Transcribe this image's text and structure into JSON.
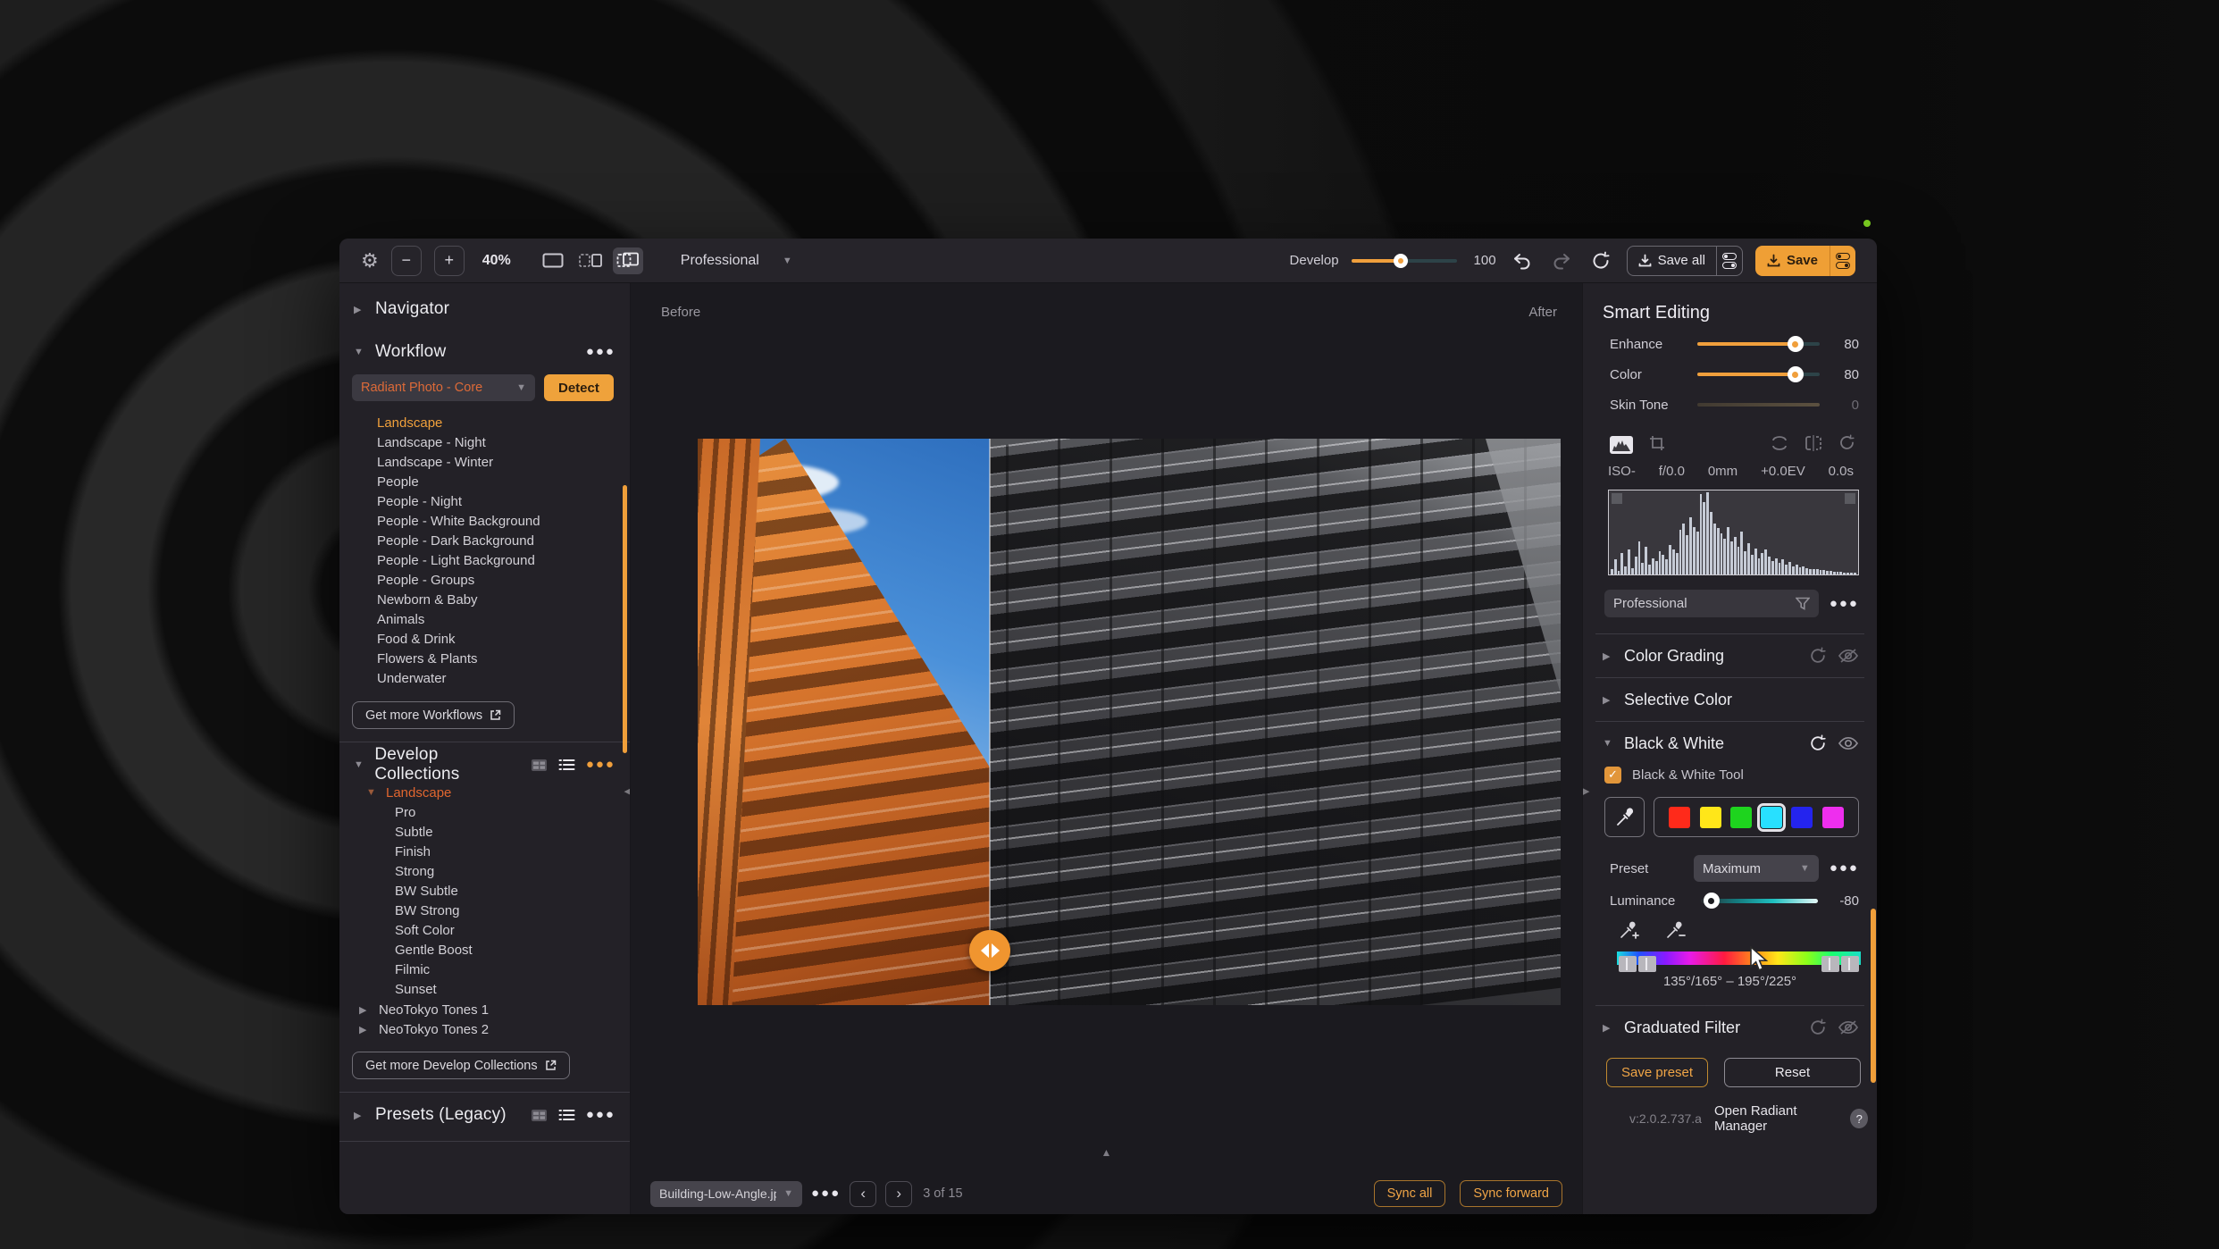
{
  "app": {
    "toolbar": {
      "zoom_value": "40%",
      "minus": "−",
      "plus": "+",
      "profile": "Professional",
      "develop_label": "Develop",
      "develop_value": "100",
      "develop_percent": 47,
      "save_all_label": "Save all",
      "save_label": "Save"
    },
    "sidebar": {
      "navigator_title": "Navigator",
      "workflow": {
        "title": "Workflow",
        "engine_value": "Radiant Photo - Core",
        "detect_label": "Detect",
        "items": [
          {
            "label": "Landscape",
            "selected": true
          },
          "Landscape - Night",
          "Landscape - Winter",
          "People",
          "People - Night",
          "People - White Background",
          "People - Dark Background",
          "People - Light Background",
          "People - Groups",
          "Newborn & Baby",
          "Animals",
          "Food & Drink",
          "Flowers & Plants",
          "Underwater"
        ],
        "get_more_label": "Get more Workflows"
      },
      "develop_collections": {
        "title": "Develop Collections",
        "group_title": "Landscape",
        "items": [
          "Pro",
          "Subtle",
          "Finish",
          "Strong",
          "BW Subtle",
          "BW Strong",
          "Soft Color",
          "Gentle Boost",
          "Filmic",
          "Sunset"
        ],
        "collapsed_groups": [
          "NeoTokyo Tones 1",
          "NeoTokyo Tones 2"
        ],
        "get_more_label": "Get more Develop Collections"
      },
      "presets_title": "Presets (Legacy)"
    },
    "canvas": {
      "before_label": "Before",
      "after_label": "After",
      "filename": "Building-Low-Angle.jp",
      "counter": "3 of 15",
      "sync_all_label": "Sync all",
      "sync_forward_label": "Sync forward"
    },
    "panel": {
      "title": "Smart Editing",
      "sliders": [
        {
          "label": "Enhance",
          "value": "80",
          "percent": 80,
          "disabled": false
        },
        {
          "label": "Color",
          "value": "80",
          "percent": 80,
          "disabled": false
        },
        {
          "label": "Skin Tone",
          "value": "0",
          "percent": 0,
          "disabled": true
        }
      ],
      "meta": [
        "ISO-",
        "f/0.0",
        "0mm",
        "+0.0EV",
        "0.0s"
      ],
      "profile_value": "Professional",
      "sections": {
        "color_grading": "Color Grading",
        "selective_color": "Selective Color",
        "black_white": "Black & White",
        "graduated_filter": "Graduated Filter"
      },
      "bw": {
        "tool_label": "Black & White Tool",
        "preset_label": "Preset",
        "preset_value": "Maximum",
        "luminance_label": "Luminance",
        "luminance_value": "-80",
        "luminance_percent": 9,
        "hue_range": "135°/165° – 195°/225°",
        "swatches": [
          {
            "color": "#ff2a1a",
            "selected": false
          },
          {
            "color": "#ffe619",
            "selected": false
          },
          {
            "color": "#1ed41e",
            "selected": false
          },
          {
            "color": "#28e0ff",
            "selected": true
          },
          {
            "color": "#2424ee",
            "selected": false
          },
          {
            "color": "#ee2eee",
            "selected": false
          }
        ]
      },
      "save_preset_label": "Save preset",
      "reset_label": "Reset",
      "version": "v:2.0.2.737.a",
      "manager_label": "Open Radiant Manager",
      "help_label": "?"
    },
    "histogram": {
      "bars": [
        6,
        18,
        4,
        26,
        10,
        30,
        8,
        22,
        40,
        14,
        34,
        12,
        20,
        16,
        28,
        24,
        18,
        36,
        30,
        26,
        54,
        62,
        48,
        70,
        58,
        52,
        98,
        88,
        100,
        76,
        62,
        56,
        50,
        44,
        58,
        40,
        46,
        34,
        52,
        28,
        38,
        24,
        32,
        20,
        26,
        30,
        22,
        16,
        20,
        14,
        18,
        12,
        15,
        10,
        12,
        9,
        10,
        8,
        7,
        6,
        6,
        5,
        5,
        4,
        4,
        3,
        3,
        3,
        2,
        2,
        2,
        2
      ]
    },
    "colors": {
      "accent": "#f09f3c",
      "engine_text": "#dd6a38",
      "selection": "#f0a03c"
    }
  }
}
